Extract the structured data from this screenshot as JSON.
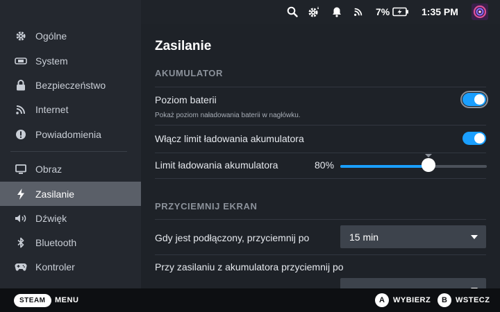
{
  "topbar": {
    "battery_percent": "7%",
    "time": "1:35 PM",
    "accent_color": "#1a9fff"
  },
  "sidebar": {
    "items": [
      {
        "label": "Ogólne",
        "icon": "gear-icon"
      },
      {
        "label": "System",
        "icon": "steamdeck-icon"
      },
      {
        "label": "Bezpieczeństwo",
        "icon": "lock-icon"
      },
      {
        "label": "Internet",
        "icon": "wifi-icon"
      },
      {
        "label": "Powiadomienia",
        "icon": "notification-icon"
      },
      {
        "label": "Obraz",
        "icon": "monitor-icon"
      },
      {
        "label": "Zasilanie",
        "icon": "bolt-icon",
        "active": true
      },
      {
        "label": "Dźwięk",
        "icon": "speaker-icon"
      },
      {
        "label": "Bluetooth",
        "icon": "bluetooth-icon"
      },
      {
        "label": "Kontroler",
        "icon": "gamepad-icon"
      }
    ]
  },
  "main": {
    "title": "Zasilanie",
    "battery_section": {
      "header": "AKUMULATOR",
      "battery_level_label": "Poziom baterii",
      "battery_level_desc": "Pokaż poziom naładowania baterii w nagłówku.",
      "battery_level_on": true,
      "charge_limit_toggle_label": "Włącz limit ładowania akumulatora",
      "charge_limit_toggle_on": true,
      "charge_limit_label": "Limit ładowania akumulatora",
      "charge_limit_value": "80%",
      "charge_limit_fraction": 0.6
    },
    "dim_section": {
      "header": "PRZYCIEMNIJ EKRAN",
      "plugged_label": "Gdy jest podłączony, przyciemnij po",
      "plugged_value": "15 min",
      "battery_label": "Przy zasilaniu z akumulatora przyciemnij po"
    }
  },
  "footer": {
    "steam_label": "STEAM",
    "menu_label": "MENU",
    "a_button": "A",
    "select_label": "WYBIERZ",
    "b_button": "B",
    "back_label": "WSTECZ"
  }
}
